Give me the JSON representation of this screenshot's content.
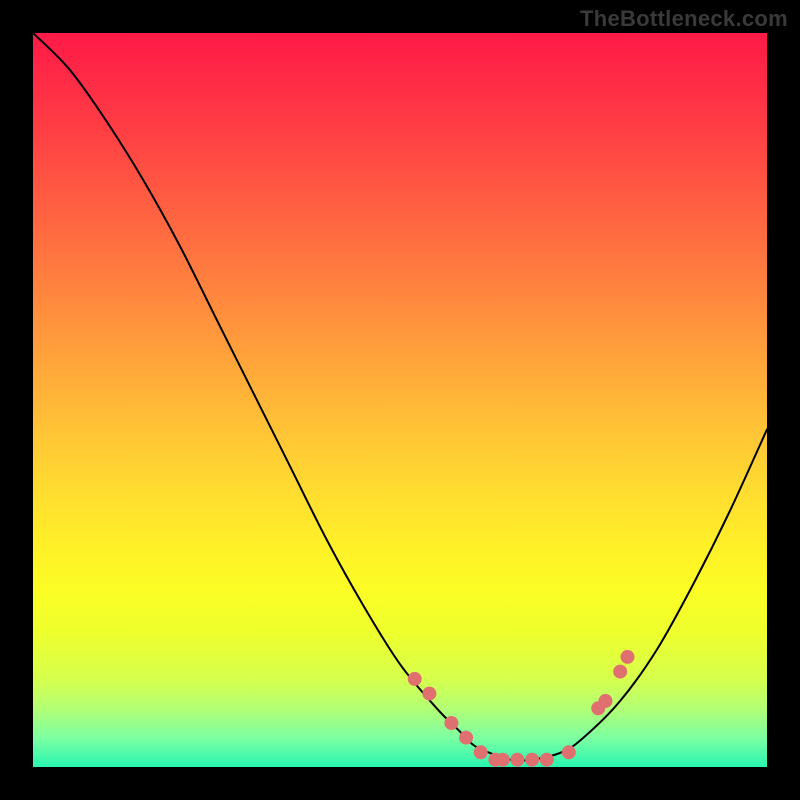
{
  "watermark": "TheBottleneck.com",
  "colors": {
    "background": "#000000",
    "gradient_top": "#ff1a47",
    "gradient_bottom": "#29f6b0",
    "curve": "#000000",
    "points": "#e07070"
  },
  "chart_data": {
    "type": "line",
    "title": "",
    "xlabel": "",
    "ylabel": "",
    "xlim": [
      0,
      100
    ],
    "ylim": [
      0,
      100
    ],
    "note": "No axes or tick labels are rendered in the image; values are estimated from pixel positions on a 0–100 scale where y=0 is the bottom (green) and y=100 is the top (red).",
    "series": [
      {
        "name": "bottleneck-curve",
        "x": [
          0,
          5,
          10,
          15,
          20,
          25,
          30,
          35,
          40,
          45,
          50,
          55,
          58,
          60,
          62,
          65,
          68,
          72,
          75,
          80,
          85,
          90,
          95,
          100
        ],
        "y": [
          100,
          95,
          88,
          80,
          71,
          61,
          51,
          41,
          31,
          22,
          14,
          8,
          5,
          3,
          2,
          1,
          1,
          2,
          4,
          9,
          16,
          25,
          35,
          46
        ]
      }
    ],
    "scatter": {
      "name": "highlight-points",
      "x": [
        52,
        54,
        57,
        59,
        61,
        63,
        64,
        66,
        68,
        70,
        73,
        77,
        78,
        80,
        81
      ],
      "y": [
        12,
        10,
        6,
        4,
        2,
        1,
        1,
        1,
        1,
        1,
        2,
        8,
        9,
        13,
        15
      ]
    }
  }
}
